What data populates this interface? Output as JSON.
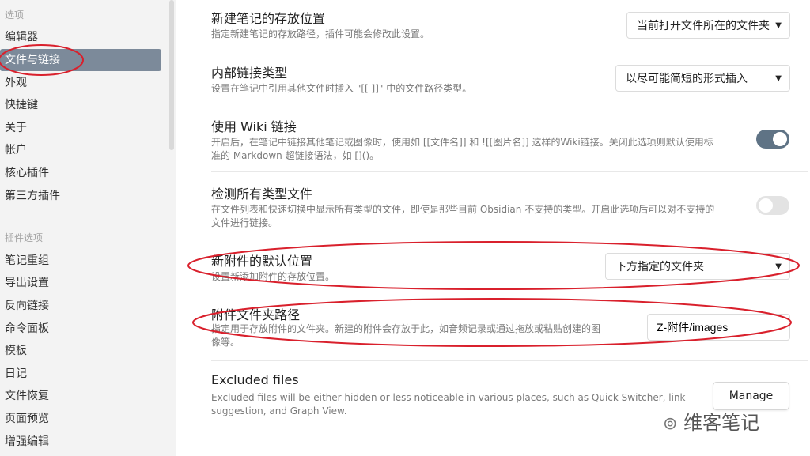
{
  "sidebar": {
    "section_options": "选项",
    "options": [
      "编辑器",
      "文件与链接",
      "外观",
      "快捷键",
      "关于",
      "帐户",
      "核心插件",
      "第三方插件"
    ],
    "section_plugin_options": "插件选项",
    "plugin_options": [
      "笔记重组",
      "导出设置",
      "反向链接",
      "命令面板",
      "模板",
      "日记",
      "文件恢复",
      "页面预览",
      "增强编辑"
    ]
  },
  "settings": [
    {
      "title": "新建笔记的存放位置",
      "desc": "指定新建笔记的存放路径，插件可能会修改此设置。",
      "control": "dropdown",
      "value": "当前打开文件所在的文件夹"
    },
    {
      "title": "内部链接类型",
      "desc": "设置在笔记中引用其他文件时插入 \"[[ ]]\" 中的文件路径类型。",
      "control": "dropdown",
      "value": "以尽可能简短的形式插入"
    },
    {
      "title": "使用 Wiki 链接",
      "desc1": "开启后，在笔记中链接其他笔记或图像时，使用如 [[文件名]] 和 ![[图片名]] 这样的Wiki链接。关闭此选项则默认使用标",
      "desc2": "准的 Markdown 超链接语法，如 []()。",
      "control": "toggle",
      "on": true
    },
    {
      "title": "检测所有类型文件",
      "desc1": "在文件列表和快速切换中显示所有类型的文件，即使是那些目前 Obsidian 不支持的类型。开启此选项后可以对不支持的",
      "desc2": "文件进行链接。",
      "control": "toggle",
      "on": false
    },
    {
      "title": "新附件的默认位置",
      "desc": "设置新添加附件的存放位置。",
      "control": "dropdown",
      "value": "下方指定的文件夹"
    },
    {
      "title": "附件文件夹路径",
      "desc1": "指定用于存放附件的文件夹。新建的附件会存放于此，如音频记录或通过拖放或粘贴创建的图",
      "desc2": "像等。",
      "control": "text",
      "value": "Z-附件/images"
    },
    {
      "title": "Excluded files",
      "desc1": "Excluded files will be either hidden or less noticeable in various places, such as Quick Switcher, link",
      "desc2": "suggestion, and Graph View.",
      "control": "button",
      "value": "Manage"
    }
  ],
  "watermark": "维客笔记",
  "colors": {
    "toggle_on": "#5f7385",
    "toggle_off": "#e3e3e3",
    "highlight": "#d9202c"
  }
}
